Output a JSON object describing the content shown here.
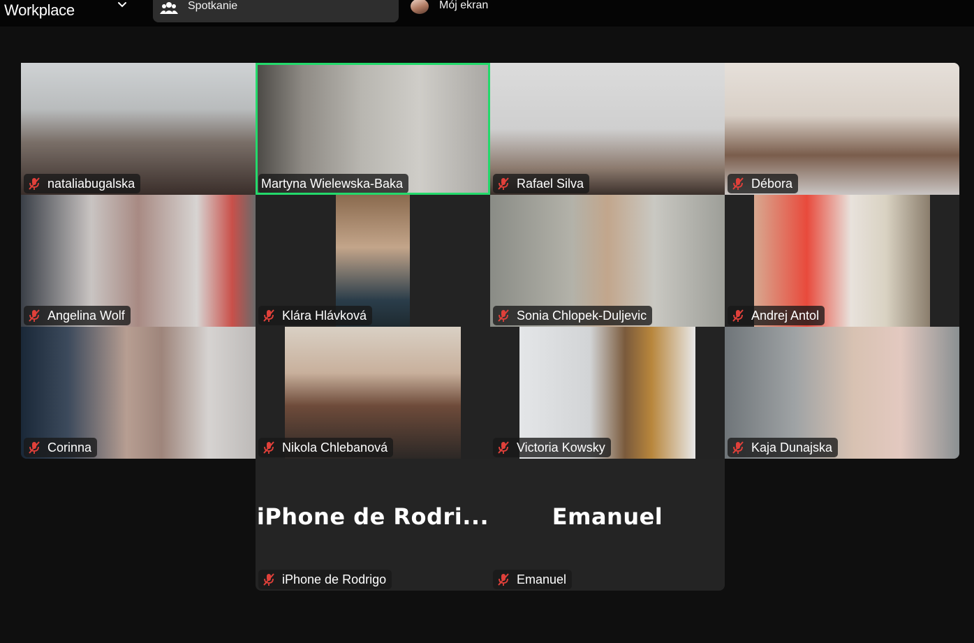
{
  "app": {
    "title": "Workplace"
  },
  "tabs": {
    "meeting_label": "Spotkanie",
    "screen_label": "Mój ekran"
  },
  "participants": [
    {
      "name": "nataliabugalska",
      "muted": true
    },
    {
      "name": "Martyna Wielewska-Baka",
      "muted": false,
      "speaking": true
    },
    {
      "name": "Rafael Silva",
      "muted": true
    },
    {
      "name": "Débora",
      "muted": true
    },
    {
      "name": "Angelina Wolf",
      "muted": true
    },
    {
      "name": "Klára Hlávková",
      "muted": true
    },
    {
      "name": "Sonia Chlopek-Duljevic",
      "muted": true
    },
    {
      "name": "Andrej Antol",
      "muted": true
    },
    {
      "name": "Corinna",
      "muted": true
    },
    {
      "name": "Nikola Chlebanová",
      "muted": true
    },
    {
      "name": "Victoria Kowsky",
      "muted": true
    },
    {
      "name": "Kaja Dunajska",
      "muted": true
    },
    {
      "name": "iPhone de Rodrigo",
      "display": "iPhone de Rodri...",
      "muted": true,
      "video": false
    },
    {
      "name": "Emanuel",
      "display": "Emanuel",
      "muted": true,
      "video": false
    }
  ],
  "colors": {
    "background": "#0f0f0f",
    "active_speaker_border": "#23d96b",
    "muted_icon": "#e0403a"
  },
  "icons": {
    "dropdown": "chevron-down-icon",
    "meeting_tab": "participants-icon",
    "muted": "microphone-muted-icon"
  }
}
